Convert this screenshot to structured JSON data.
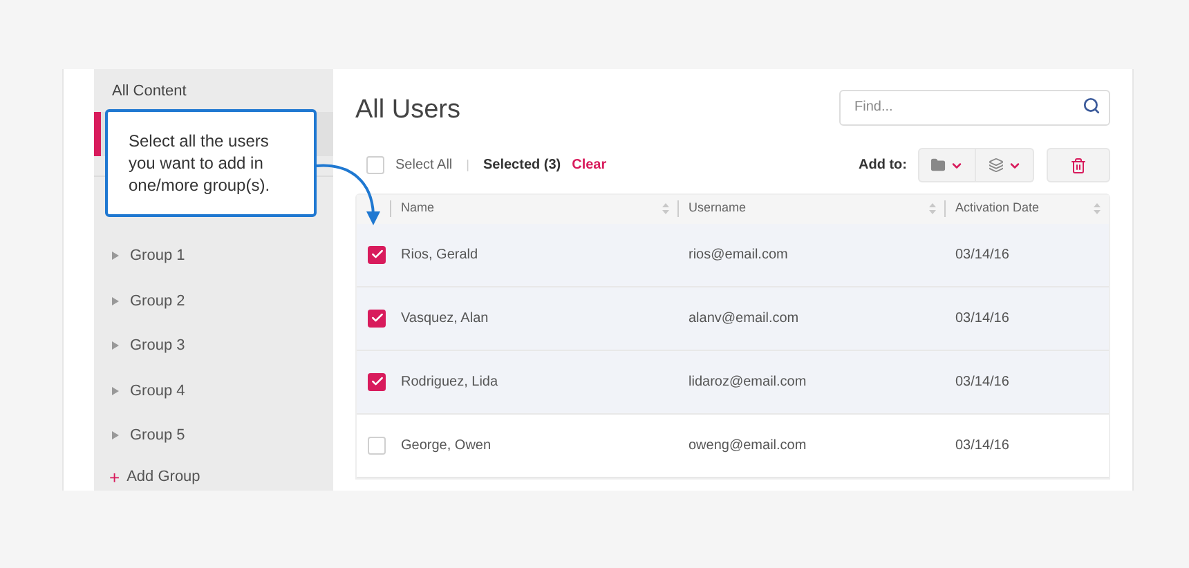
{
  "sidebar": {
    "heading": "All Content",
    "selected_item": {
      "selected": true
    },
    "groups": [
      {
        "label": "Group 1",
        "expanded": false
      },
      {
        "label": "Group 2",
        "expanded": false
      },
      {
        "label": "Group 3",
        "expanded": false
      },
      {
        "label": "Group 4",
        "expanded": false
      },
      {
        "label": "Group 5",
        "expanded": false
      }
    ],
    "add_group": {
      "icon": "+",
      "label": "Add Group"
    }
  },
  "callout": {
    "text": "Select all the users you want to add in one/more group(s)."
  },
  "main": {
    "title": "All Users",
    "search": {
      "placeholder": "Find..."
    },
    "select_all": {
      "label": "Select All",
      "checked": false
    },
    "separator": "|",
    "selected_count": "Selected (3)",
    "clear": "Clear",
    "add_to": "Add to:"
  },
  "table": {
    "columns": [
      "Name",
      "Username",
      "Activation Date"
    ],
    "rows": [
      {
        "name": "Rios, Gerald",
        "username": "rios@email.com",
        "date": "03/14/16",
        "selected": true
      },
      {
        "name": "Vasquez, Alan",
        "username": "alanv@email.com",
        "date": "03/14/16",
        "selected": true
      },
      {
        "name": "Rodriguez, Lida",
        "username": "lidaroz@email.com",
        "date": "03/14/16",
        "selected": true
      },
      {
        "name": "George, Owen",
        "username": "oweng@email.com",
        "date": "03/14/16",
        "selected": false
      }
    ]
  }
}
